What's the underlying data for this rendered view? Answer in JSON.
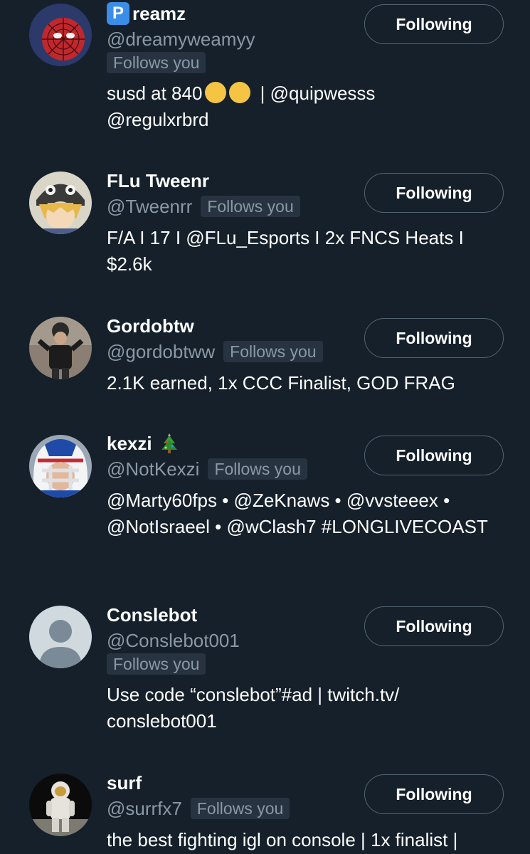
{
  "users": [
    {
      "display_name": "reamz",
      "name_prefix_glyph": "P",
      "handle": "@dreamyweamyy",
      "follows_you": "Follows you",
      "badge_inline": false,
      "bio_lines": [
        "susd at 840",
        "@regulxrbrd"
      ],
      "bio_emoji_after_first": [
        "neutral-face-emoji",
        "sad-tear-emoji"
      ],
      "bio_after_emoji": " | @quipwesss",
      "button": "Following",
      "avatar": "spiderman-avatar"
    },
    {
      "display_name": "FLu Tweenr",
      "handle": "@Tweenrr",
      "follows_you": "Follows you",
      "badge_inline": true,
      "bio": "F/A I 17 I @FLu_Esports I 2x FNCS Heats I $2.6k",
      "button": "Following",
      "avatar": "anime-avatar"
    },
    {
      "display_name": "Gordobtw",
      "handle": "@gordobtww",
      "follows_you": "Follows you",
      "badge_inline": true,
      "bio": "2.1K earned, 1x CCC Finalist, GOD FRAG",
      "button": "Following",
      "avatar": "photo-avatar"
    },
    {
      "display_name": "kexzi",
      "handle": "@NotKexzi",
      "follows_you": "Follows you",
      "badge_inline": true,
      "bio": "@Marty60fps • @ZeKnaws • @vvsteeex • @NotIsraeel • @wClash7 #LONGLIVECOAST",
      "button": "Following",
      "avatar": "football-helmet-avatar"
    },
    {
      "display_name": "Conslebot",
      "handle": "@Conslebot001",
      "follows_you": "Follows you",
      "badge_inline": false,
      "bio": "Use code “conslebot”#ad | twitch.tv/ conslebot001",
      "button": "Following",
      "avatar": "default-avatar"
    },
    {
      "display_name": "surf",
      "handle": "@surrfx7",
      "follows_you": "Follows you",
      "badge_inline": true,
      "bio": "the best fighting igl on console | 1x finalist |",
      "button": "Following",
      "avatar": "astronaut-avatar"
    }
  ],
  "colors": {
    "background": "#15202b",
    "secondary_text": "#8b98a5",
    "badge_bg": "#273340",
    "button_border": "#536471"
  }
}
